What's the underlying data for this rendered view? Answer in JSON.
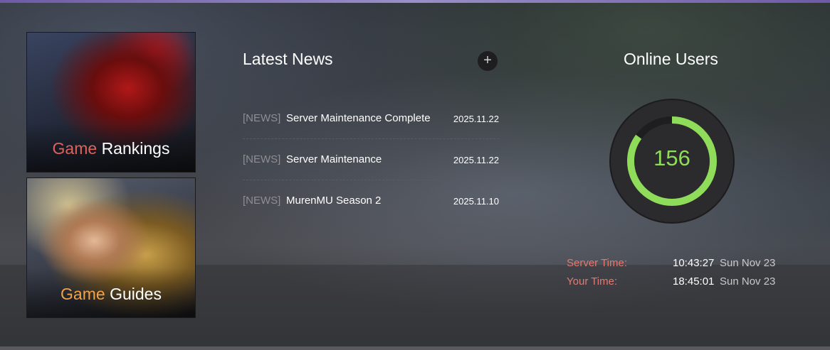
{
  "promos": {
    "rankings": {
      "accent": "Game",
      "label": "Rankings"
    },
    "guides": {
      "accent": "Game",
      "label": "Guides"
    }
  },
  "news": {
    "title": "Latest News",
    "more_icon": "+",
    "items": [
      {
        "tag": "[NEWS]",
        "title": "Server Maintenance Complete",
        "date": "2025.11.22"
      },
      {
        "tag": "[NEWS]",
        "title": "Server Maintenance",
        "date": "2025.11.22"
      },
      {
        "tag": "[NEWS]",
        "title": "MurenMU Season 2",
        "date": "2025.11.10"
      }
    ]
  },
  "online": {
    "title": "Online Users",
    "count": "156",
    "ring_fill_fraction": 0.85,
    "ring_color": "#8fdc5a"
  },
  "time": {
    "server": {
      "label": "Server Time:",
      "clock": "10:43:27",
      "day": "Sun Nov 23"
    },
    "yours": {
      "label": "Your Time:",
      "clock": "18:45:01",
      "day": "Sun Nov 23"
    }
  },
  "colors": {
    "accent_red": "#e0625a",
    "accent_orange": "#f0a24a",
    "label_red": "#e27a72"
  }
}
